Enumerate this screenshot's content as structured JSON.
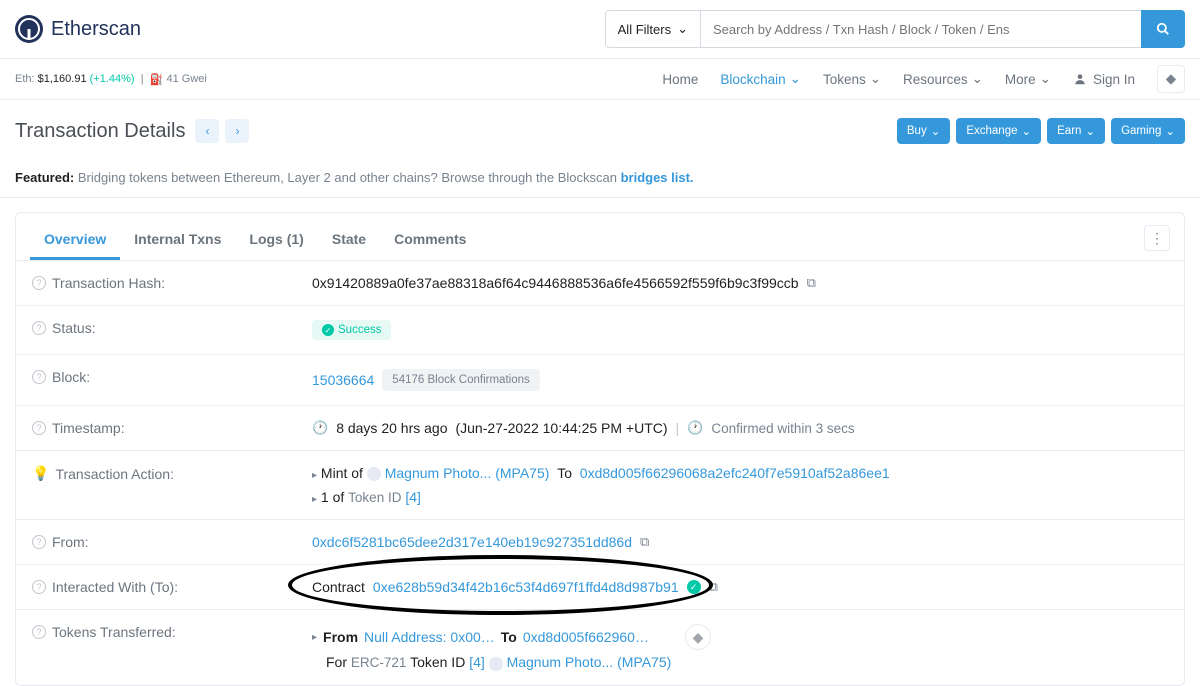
{
  "header": {
    "brand": "Etherscan",
    "filter_label": "All Filters",
    "search_placeholder": "Search by Address / Txn Hash / Block / Token / Ens"
  },
  "subheader": {
    "eth_label": "Eth:",
    "eth_price": "$1,160.91",
    "eth_pct": "(+1.44%)",
    "gas": "41 Gwei"
  },
  "nav": {
    "home": "Home",
    "blockchain": "Blockchain",
    "tokens": "Tokens",
    "resources": "Resources",
    "more": "More",
    "signin": "Sign In"
  },
  "page": {
    "title": "Transaction Details"
  },
  "actions": {
    "buy": "Buy",
    "exchange": "Exchange",
    "earn": "Earn",
    "gaming": "Gaming"
  },
  "featured": {
    "label": "Featured:",
    "text": "Bridging tokens between Ethereum, Layer 2 and other chains? Browse through the Blockscan ",
    "link": "bridges list."
  },
  "tabs": {
    "overview": "Overview",
    "internal": "Internal Txns",
    "logs": "Logs (1)",
    "state": "State",
    "comments": "Comments"
  },
  "labels": {
    "txhash": "Transaction Hash:",
    "status": "Status:",
    "block": "Block:",
    "timestamp": "Timestamp:",
    "action": "Transaction Action:",
    "from": "From:",
    "to": "Interacted With (To):",
    "transferred": "Tokens Transferred:"
  },
  "values": {
    "txhash": "0x91420889a0fe37ae88318a6f64c9446888536a6fe4566592f559f6b9c3f99ccb",
    "status": "Success",
    "block": "15036664",
    "confirmations": "54176 Block Confirmations",
    "timestamp_rel": "8 days 20 hrs ago",
    "timestamp_abs": "(Jun-27-2022 10:44:25 PM +UTC)",
    "confirmed_in": "Confirmed within 3 secs",
    "mint_of": "Mint of",
    "mint_token": "Magnum Photo... (MPA75)",
    "mint_to": "To",
    "mint_addr": "0xd8d005f66296068a2efc240f7e5910af52a86ee1",
    "mint_count": "1 of",
    "mint_tokenid_label": "Token ID",
    "mint_tokenid": "[4]",
    "from_addr": "0xdc6f5281bc65dee2d317e140eb19c927351dd86d",
    "to_label": "Contract",
    "to_addr": "0xe628b59d34f42b16c53f4d697f1ffd4d8d987b91",
    "xfer_from": "From",
    "xfer_null": "Null Address: 0x00…",
    "xfer_to": "To",
    "xfer_to_addr": "0xd8d005f662960…",
    "xfer_for": "For",
    "xfer_erc": "ERC-721",
    "xfer_tokenid_label": "Token ID",
    "xfer_tokenid": "[4]",
    "xfer_token": "Magnum Photo... (MPA75)"
  }
}
